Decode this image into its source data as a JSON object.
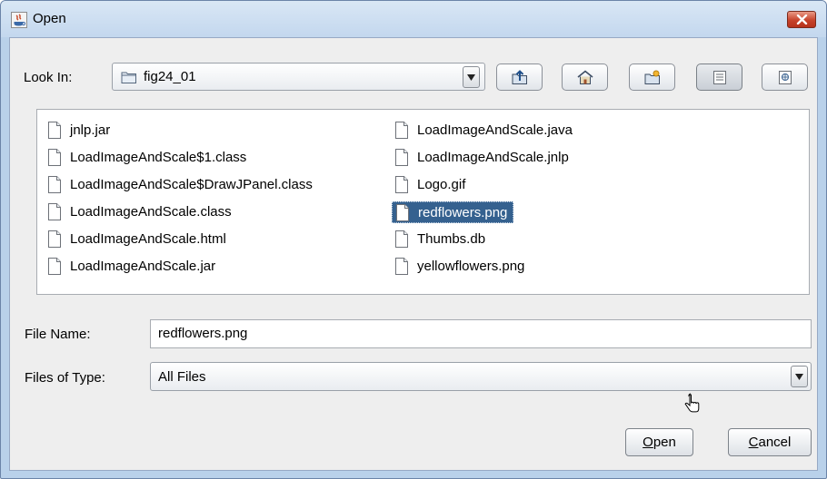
{
  "window": {
    "title": "Open"
  },
  "lookin": {
    "label": "Look In:",
    "value": "fig24_01"
  },
  "toolbar": {
    "buttons": [
      {
        "name": "up-one-level-button",
        "icon": "folder-up-icon"
      },
      {
        "name": "home-button",
        "icon": "home-icon"
      },
      {
        "name": "create-new-folder-button",
        "icon": "new-folder-icon"
      },
      {
        "name": "list-view-button",
        "icon": "list-icon",
        "active": true
      },
      {
        "name": "details-view-button",
        "icon": "details-icon"
      }
    ]
  },
  "files": [
    {
      "name": "jnlp.jar"
    },
    {
      "name": "LoadImageAndScale$1.class"
    },
    {
      "name": "LoadImageAndScale$DrawJPanel.class"
    },
    {
      "name": "LoadImageAndScale.class"
    },
    {
      "name": "LoadImageAndScale.html"
    },
    {
      "name": "LoadImageAndScale.jar"
    },
    {
      "name": "LoadImageAndScale.java"
    },
    {
      "name": "LoadImageAndScale.jnlp"
    },
    {
      "name": "Logo.gif"
    },
    {
      "name": "redflowers.png",
      "selected": true
    },
    {
      "name": "Thumbs.db"
    },
    {
      "name": "yellowflowers.png"
    }
  ],
  "filename": {
    "label": "File Name:",
    "value": "redflowers.png"
  },
  "filetype": {
    "label": "Files of Type:",
    "value": "All Files"
  },
  "buttons": {
    "open": {
      "mnemonic": "O",
      "rest": "pen"
    },
    "cancel": {
      "mnemonic": "C",
      "rest": "ancel"
    }
  },
  "colors": {
    "selection": "#35618f",
    "window_frame": "#b9d1ea",
    "close_button": "#c7432b"
  }
}
